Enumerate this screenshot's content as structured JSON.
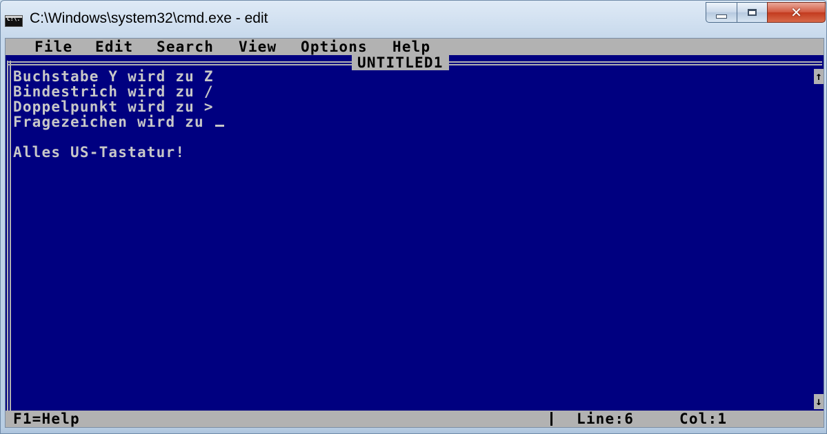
{
  "window": {
    "title": "C:\\Windows\\system32\\cmd.exe - edit",
    "icon_label": "C:\\."
  },
  "menu": {
    "items": [
      "File",
      "Edit",
      "Search",
      "View",
      "Options",
      "Help"
    ]
  },
  "document": {
    "name": "UNTITLED1",
    "lines": [
      "Buchstabe Y wird zu Z",
      "Bindestrich wird zu /",
      "Doppelpunkt wird zu >",
      "Fragezeichen wird zu _",
      "",
      "Alles US-Tastatur!"
    ]
  },
  "scrollbar": {
    "up_arrow": "↑",
    "down_arrow": "↓"
  },
  "status": {
    "help_hint": "F1=Help",
    "line": "Line:6",
    "col": "Col:1"
  },
  "colors": {
    "console_background": "#000080",
    "console_text": "#c8c8c8",
    "bar_background": "#b2b2b2",
    "close_button": "#c23a1e"
  },
  "icons": [
    "cmd-icon",
    "minimize-icon",
    "maximize-icon",
    "close-icon",
    "scroll-up-icon",
    "scroll-down-icon"
  ]
}
